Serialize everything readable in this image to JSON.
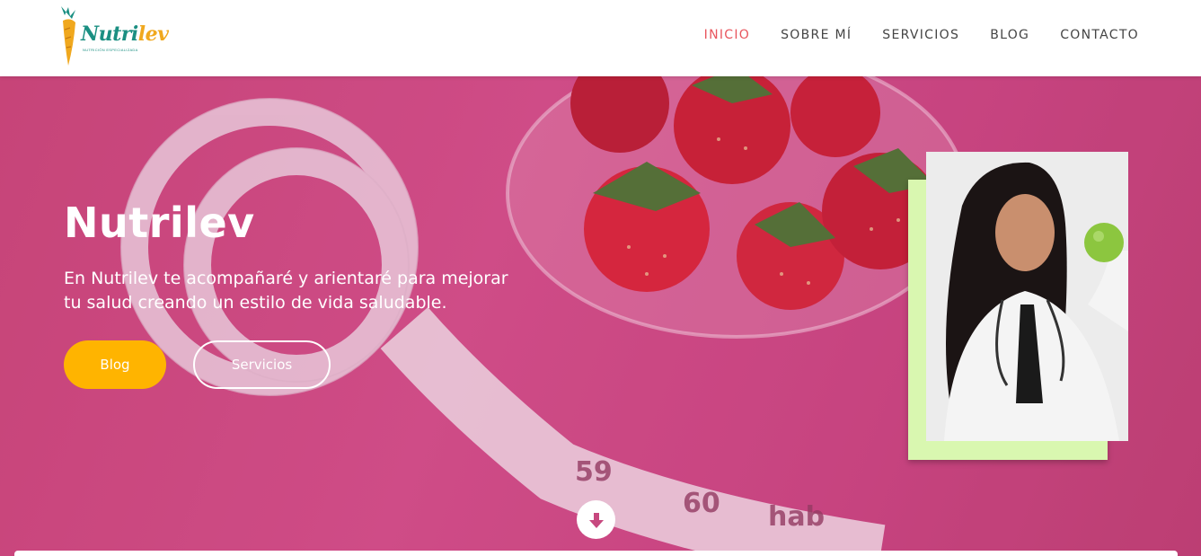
{
  "header": {
    "logo": {
      "text_main": "Nutri",
      "text_accent": "lev",
      "tagline": "NUTRICIÓN ESPECIALIZADA",
      "icon": "carrot-icon"
    },
    "nav": [
      {
        "label": "INICIO",
        "active": true
      },
      {
        "label": "SOBRE MÍ",
        "active": false
      },
      {
        "label": "SERVICIOS",
        "active": false
      },
      {
        "label": "BLOG",
        "active": false
      },
      {
        "label": "CONTACTO",
        "active": false
      }
    ]
  },
  "hero": {
    "title": "Nutrilev",
    "text": "En Nutrilev te acompañaré y arientaré para mejorar tu salud creando un estilo de vida saludable.",
    "buttons": {
      "blog": "Blog",
      "servicios": "Servicios"
    },
    "scroll_icon": "arrow-down-icon"
  },
  "colors": {
    "nav_active": "#e8555d",
    "nav_text": "#444444",
    "hero_bg": "#d2508a",
    "blog_button": "#ffb400",
    "photo_frame": "#d9f7b0",
    "logo_green": "#1b8f82",
    "logo_orange": "#f0a81e"
  }
}
